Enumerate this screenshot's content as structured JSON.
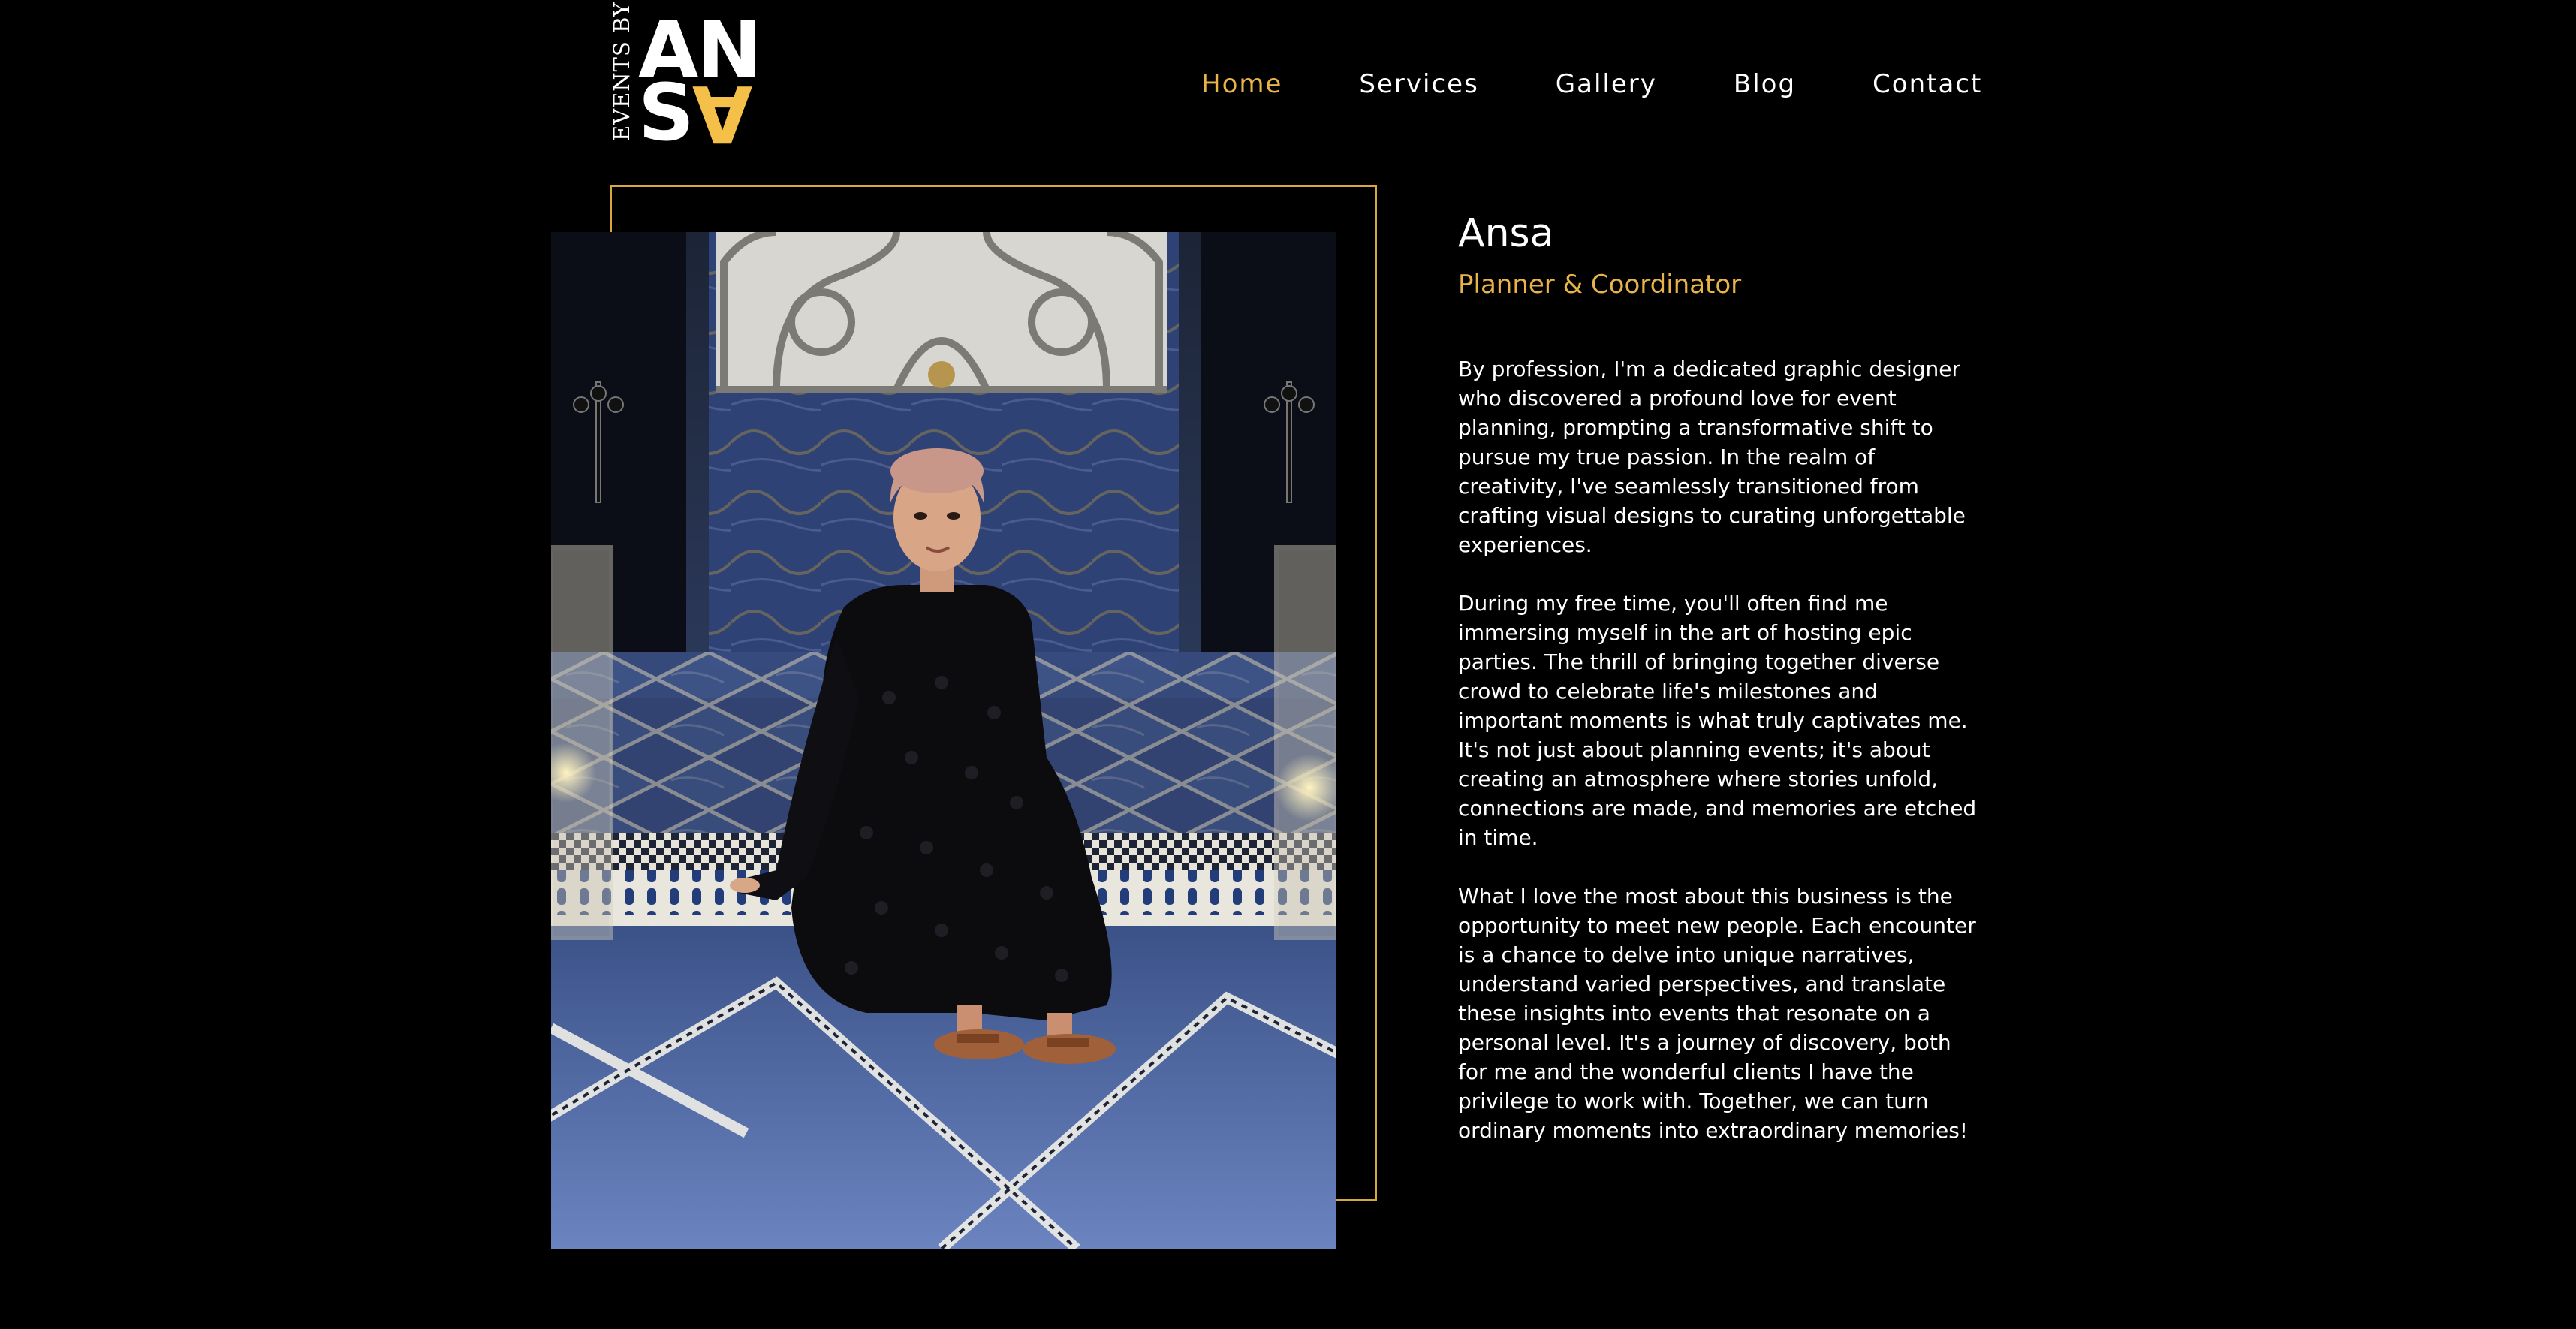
{
  "logo": {
    "side_text": "EVENTS BY",
    "top_letters": "AN",
    "bottom_s": "S",
    "bottom_a": "A"
  },
  "nav": {
    "items": [
      {
        "label": "Home",
        "active": true
      },
      {
        "label": "Services",
        "active": false
      },
      {
        "label": "Gallery",
        "active": false
      },
      {
        "label": "Blog",
        "active": false
      },
      {
        "label": "Contact",
        "active": false
      }
    ]
  },
  "photo": {
    "alt": "Ansa seated on a blue mosaic tiled floor"
  },
  "bio": {
    "name": "Ansa",
    "role": "Planner & Coordinator",
    "paragraphs": [
      "By profession, I'm a dedicated graphic designer who discovered a profound love for event planning, prompting a transformative shift to pursue my true passion. In the realm of creativity, I've seamlessly transitioned from crafting visual designs to curating unforgettable experiences.",
      "During my free time, you'll often find me immersing myself in the art of hosting epic parties. The thrill of bringing together diverse crowd to celebrate life's milestones and important moments is what truly captivates me. It's not just about planning events; it's about creating an atmosphere where stories unfold, connections are made, and memories are etched in time.",
      "What I love the most about this business is the opportunity to meet new people. Each encounter is a chance to delve into unique narratives, understand varied perspectives, and translate these insights into events that resonate on a personal level. It's a journey of discovery, both for me and the wonderful clients I have the privilege to work with. Together, we can turn ordinary moments into extraordinary memories!"
    ]
  },
  "colors": {
    "background": "#000000",
    "accent": "#e8b44a",
    "frame": "#d9a73e",
    "text": "#ffffff"
  }
}
